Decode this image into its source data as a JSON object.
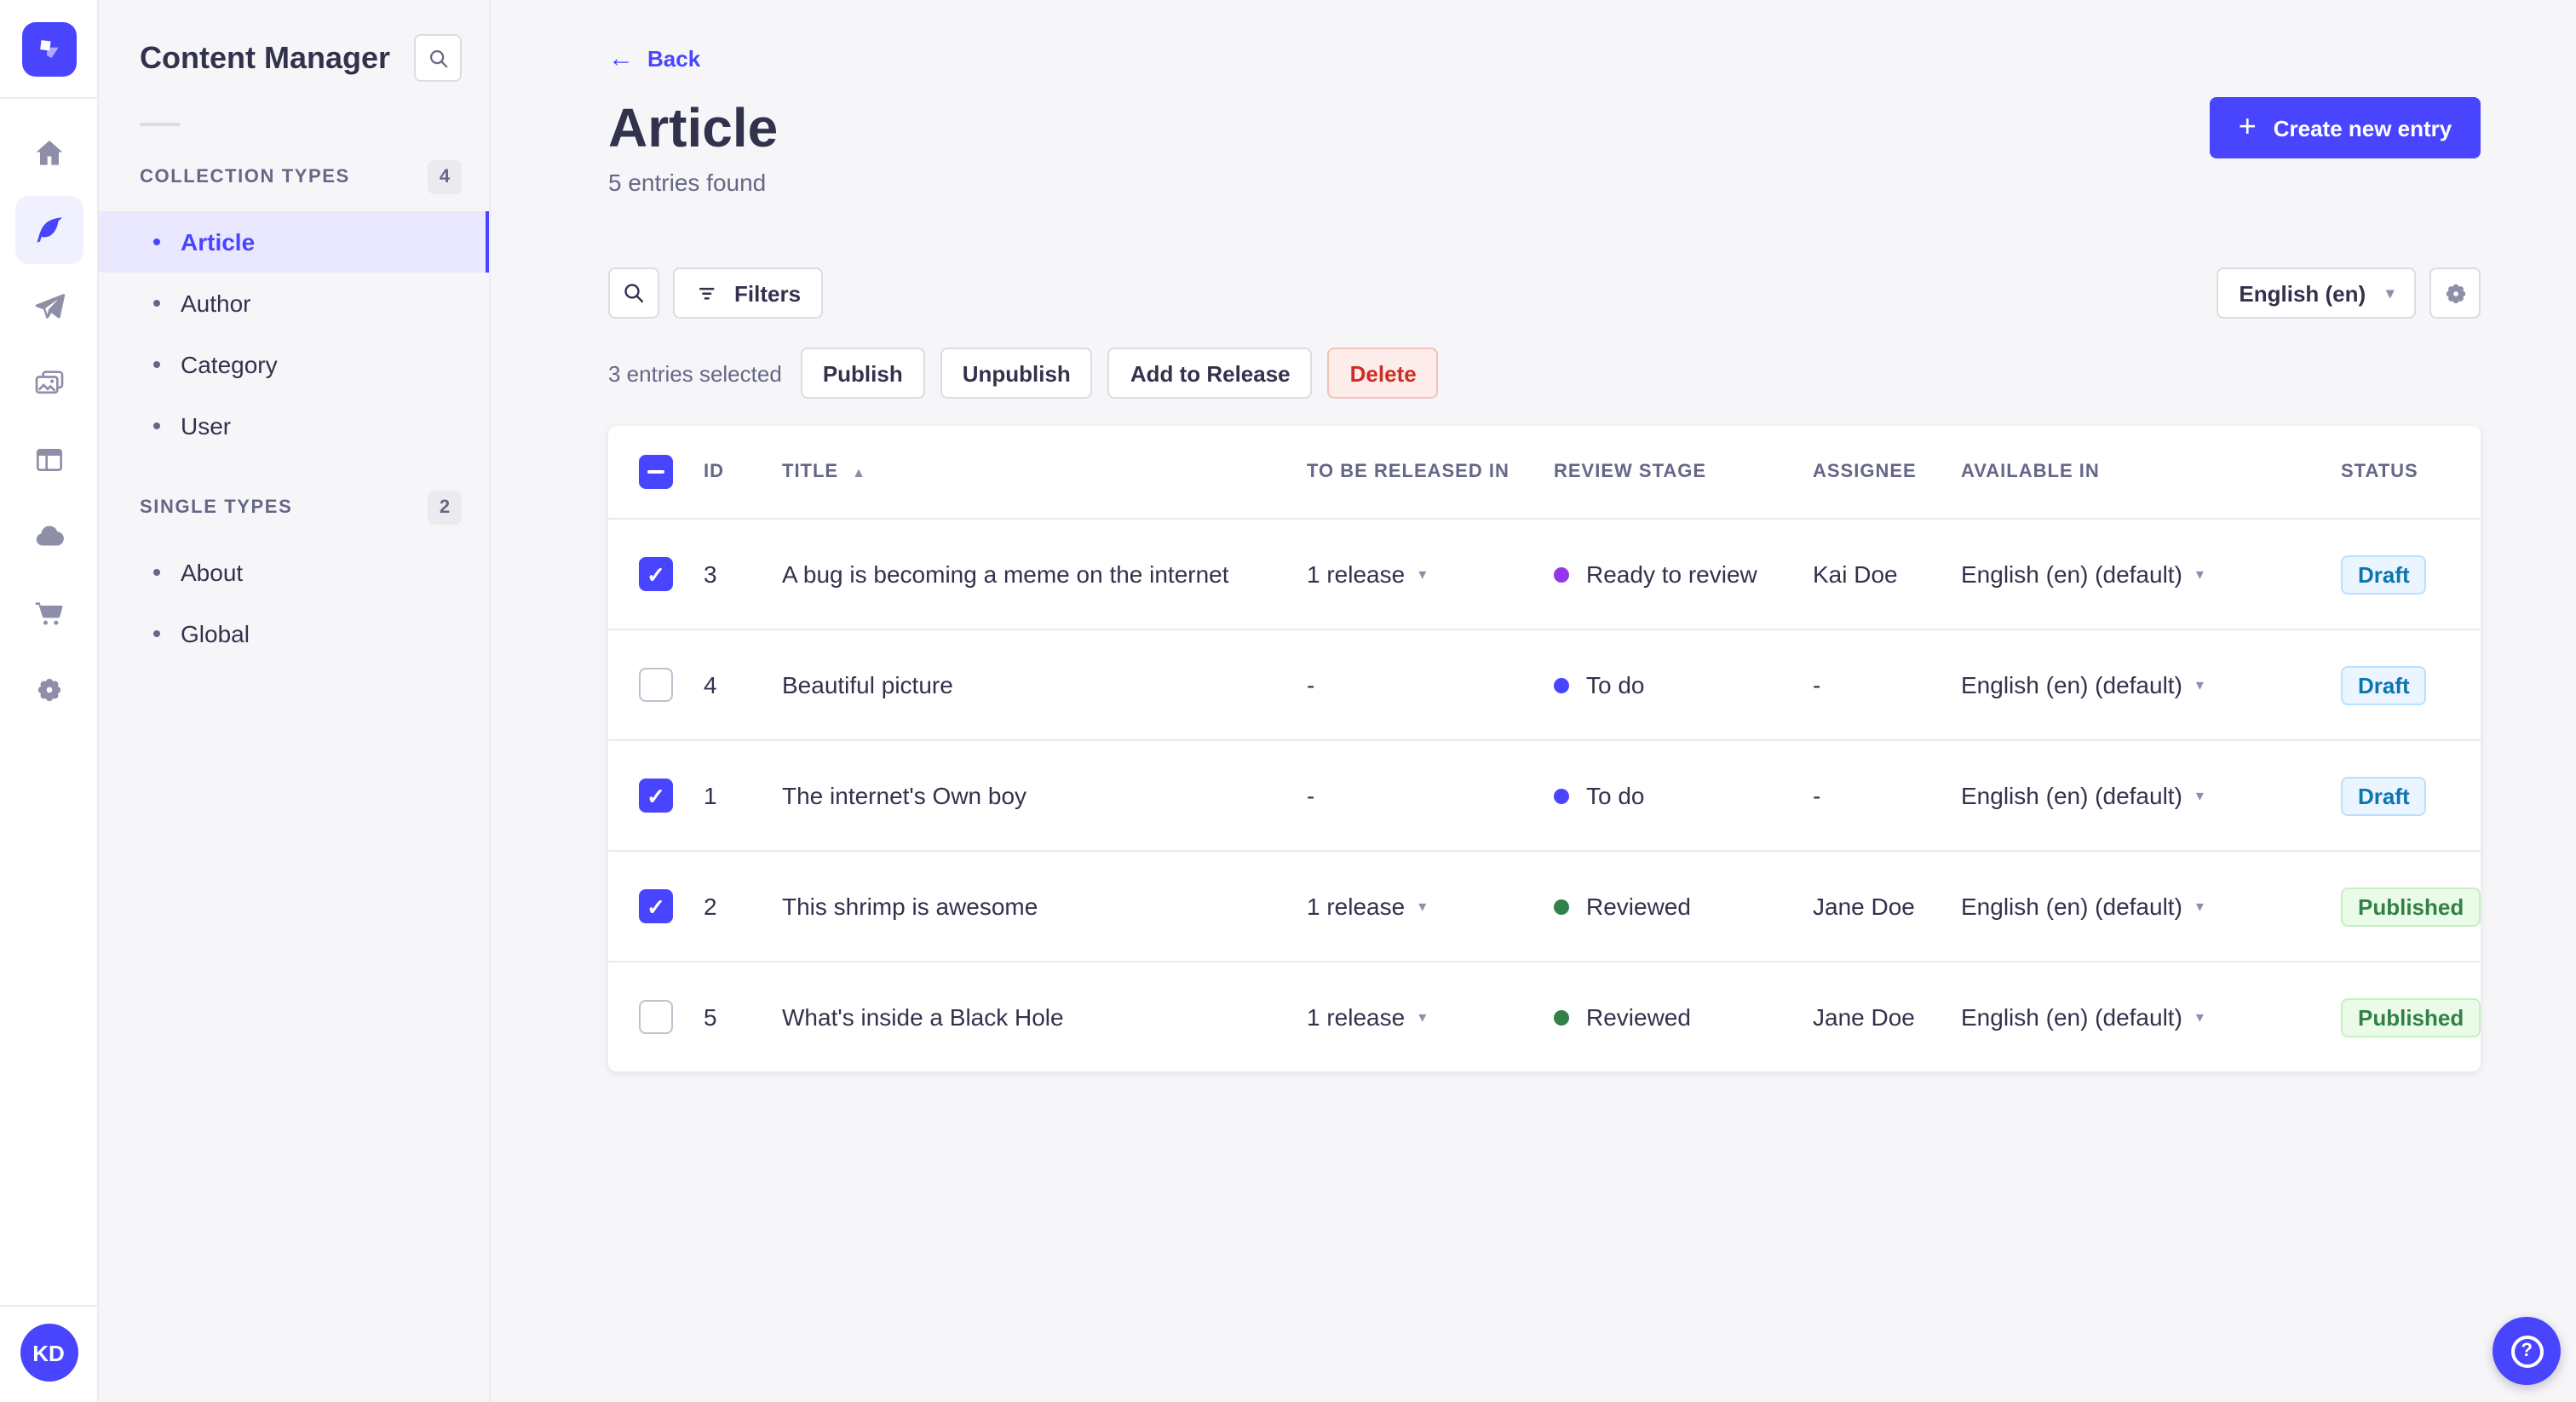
{
  "colors": {
    "primary": "#4945ff",
    "primary_light": "#e9e8ff",
    "text_dark": "#32324d",
    "text_gray": "#666687",
    "background": "#f6f6f9",
    "draft_text": "#0c75af",
    "published_text": "#328048",
    "danger_text": "#d02b20",
    "dot_ready_to_review": "#9736e8",
    "dot_to_do": "#4945ff",
    "dot_reviewed": "#328048"
  },
  "icons": {
    "back_arrow": "←",
    "plus": "+",
    "caret_down": "▾",
    "sort_asc": "▲",
    "check": "✓",
    "help": "?",
    "logo": "strapi-logo",
    "nav": [
      "home-icon",
      "content-manager-feather-icon",
      "releases-paper-plane-icon",
      "media-library-images-icon",
      "content-type-builder-layout-icon",
      "deploy-cloud-icon",
      "marketplace-cart-icon",
      "settings-gear-icon"
    ]
  },
  "sidebar": {
    "title": "Content Manager",
    "sections": [
      {
        "label": "COLLECTION TYPES",
        "count": "4",
        "items": [
          {
            "label": "Article",
            "active": true
          },
          {
            "label": "Author",
            "active": false
          },
          {
            "label": "Category",
            "active": false
          },
          {
            "label": "User",
            "active": false
          }
        ]
      },
      {
        "label": "SINGLE TYPES",
        "count": "2",
        "items": [
          {
            "label": "About",
            "active": false
          },
          {
            "label": "Global",
            "active": false
          }
        ]
      }
    ]
  },
  "header": {
    "back": "Back",
    "title": "Article",
    "subtitle": "5 entries found",
    "create_button": "Create new entry"
  },
  "toolbar": {
    "filters": "Filters",
    "locale": "English (en)"
  },
  "selection": {
    "text": "3 entries selected",
    "publish": "Publish",
    "unpublish": "Unpublish",
    "add_to_release": "Add to Release",
    "delete": "Delete"
  },
  "table": {
    "headers": {
      "id": "ID",
      "title": "TITLE",
      "release": "TO BE RELEASED IN",
      "stage": "REVIEW STAGE",
      "assignee": "ASSIGNEE",
      "available": "AVAILABLE IN",
      "status": "STATUS"
    },
    "rows": [
      {
        "selected": true,
        "id": "3",
        "title": "A bug is becoming a meme on the internet",
        "release": "1 release",
        "stage": "Ready to review",
        "stage_color": "purple",
        "assignee": "Kai Doe",
        "available": "English (en) (default)",
        "status": "Draft"
      },
      {
        "selected": false,
        "id": "4",
        "title": "Beautiful picture",
        "release": "-",
        "stage": "To do",
        "stage_color": "blue",
        "assignee": "-",
        "available": "English (en) (default)",
        "status": "Draft"
      },
      {
        "selected": true,
        "id": "1",
        "title": "The internet's Own boy",
        "release": "-",
        "stage": "To do",
        "stage_color": "blue",
        "assignee": "-",
        "available": "English (en) (default)",
        "status": "Draft"
      },
      {
        "selected": true,
        "id": "2",
        "title": "This shrimp is awesome",
        "release": "1 release",
        "stage": "Reviewed",
        "stage_color": "green",
        "assignee": "Jane Doe",
        "available": "English (en) (default)",
        "status": "Published"
      },
      {
        "selected": false,
        "id": "5",
        "title": "What's inside a Black Hole",
        "release": "1 release",
        "stage": "Reviewed",
        "stage_color": "green",
        "assignee": "Jane Doe",
        "available": "English (en) (default)",
        "status": "Published"
      }
    ]
  },
  "user": {
    "initials": "KD"
  }
}
